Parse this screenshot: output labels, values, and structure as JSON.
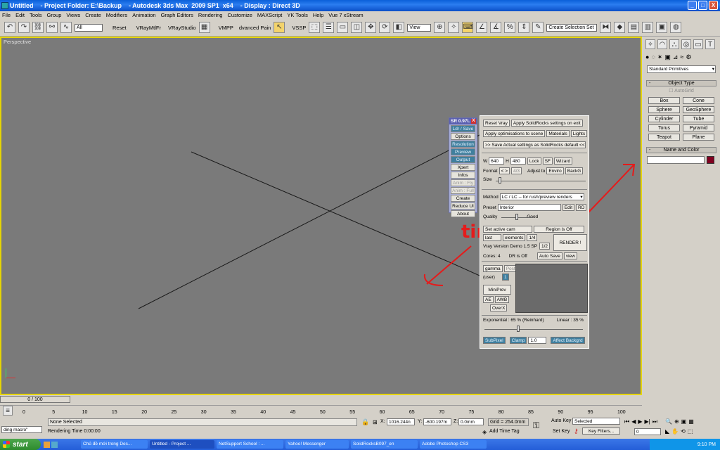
{
  "window": {
    "title": "Untitled    - Project Folder: E:\\Backup    - Autodesk 3ds Max  2009 SP1  x64    - Display : Direct 3D",
    "btn_min": "_",
    "btn_max": "□",
    "btn_close": "X"
  },
  "menu": [
    "File",
    "Edit",
    "Tools",
    "Group",
    "Views",
    "Create",
    "Modifiers",
    "Animation",
    "Graph Editors",
    "Rendering",
    "Customize",
    "MAXScript",
    "YK Tools",
    "Help",
    "Vue 7 xStream"
  ],
  "toolbar": {
    "filter": "All",
    "reset": "Reset",
    "vray_mtl": "VRayMtlFr",
    "vray_studio": "VRayStudio",
    "vmpp": "VMPP",
    "advanced_paint": "dvanced Pain",
    "vssp": "VSSP",
    "view": "View",
    "selection_set": "Create Selection Set"
  },
  "viewport": {
    "label": "Perspective"
  },
  "command_panel": {
    "dropdown": "Standard Primitives",
    "object_type": "Object Type",
    "autogrid": "AutoGrid",
    "primitives": [
      "Box",
      "Cone",
      "Sphere",
      "GeoSphere",
      "Cylinder",
      "Tube",
      "Torus",
      "Pyramid",
      "Teapot",
      "Plane"
    ],
    "name_color": "Name and Color",
    "color": "#800020"
  },
  "sr_panel": {
    "title": "SR 0.97L",
    "close": "X",
    "items": [
      {
        "label": "Ldr / Save",
        "state": "on"
      },
      {
        "label": "Options",
        "state": "normal"
      },
      {
        "label": "Resolution",
        "state": "on"
      },
      {
        "label": "Preview",
        "state": "on"
      },
      {
        "label": "Output",
        "state": "on"
      },
      {
        "label": "Xpert",
        "state": "normal"
      },
      {
        "label": "Infos",
        "state": "normal"
      },
      {
        "label": "Anim : Fly",
        "state": "dis"
      },
      {
        "label": "Anim : Full",
        "state": "dis"
      },
      {
        "label": "Create",
        "state": "normal"
      },
      {
        "label": "Reduce UI",
        "state": "normal"
      },
      {
        "label": "About",
        "state": "normal"
      }
    ]
  },
  "main_panel": {
    "reset_vray": "Reset Vray",
    "apply_exit": "Apply SolidRocks settings on exit",
    "apply_opt": "Apply optimisations to scene",
    "materials": "Materials",
    "lights": "Lights",
    "save_default": ">> Save Actual settings as SolidRocks default <<",
    "w_label": "W",
    "w_value": "640",
    "h_label": "H",
    "h_value": "480",
    "lock": "Lock",
    "sf": "SF",
    "wizard": "Wizard",
    "format": "Format",
    "format_arrows": "< >",
    "aspect": "4/3",
    "adjust_to": "Adjust to",
    "enviro": "Enviro",
    "backg": "BackG",
    "size": "Size",
    "method_label": "Method",
    "method_value": "LC / LC -- for rush/preview renders",
    "preset_label": "Preset",
    "preset_value": "Interior",
    "edit": "Edit",
    "rd": "RD",
    "quality": "Quality",
    "good": "Good",
    "set_active": "Set active cam",
    "region": "Region is Off",
    "last": "last",
    "elements": "elements",
    "half": "1/4",
    "quarter": "1/2",
    "render": "RENDER !",
    "vray_version": "Vray Version   Demo 1.5 SP",
    "cores": "Cores: 4",
    "dr": "DR is Off",
    "autosave": "Auto Save",
    "view": "view",
    "gamma": "gamma",
    "post": "Post",
    "user": "(user)",
    "checkbox": "1",
    "miniprev": "MiniPrev",
    "ae": "AE",
    "awb": "AWB",
    "overx": "OverX",
    "exposure": "Exponential : 65 %   (Reinhard)",
    "linear": "Linear : 35 %",
    "subpixel": "SubPixel",
    "clamp": "Clamp",
    "clamp_value": "1.0",
    "affect_bg": "Affect Backgrd"
  },
  "annotations": [
    "time",
    "time"
  ],
  "timebar": {
    "slider": "0 / 100",
    "ticks": [
      "0",
      "5",
      "10",
      "15",
      "20",
      "25",
      "30",
      "35",
      "40",
      "45",
      "50",
      "55",
      "60",
      "65",
      "70",
      "75",
      "80",
      "85",
      "90",
      "95",
      "100"
    ]
  },
  "status": {
    "macro": "ding macro\"",
    "none_selected": "None Selected",
    "render_time": "Rendering Time  0:00:00",
    "x_label": "X:",
    "x_value": "1016.244n",
    "y_label": "Y:",
    "y_value": "-600.197m",
    "z_label": "Z:",
    "z_value": "0.0mm",
    "grid": "Grid = 254.0mm",
    "add_time_tag": "Add Time Tag",
    "auto_key": "Auto Key",
    "selected": "Selected",
    "set_key": "Set Key",
    "key_filters": "Key Filters...",
    "frame": "0"
  },
  "taskbar": {
    "start": "start",
    "tasks": [
      "Chủ đề mới trong Des...",
      "Untitled    - Project ...",
      "NetSupport School : ...",
      "Yahoo! Messenger",
      "SolidRocksB097_en",
      "Adobe Photoshop CS3"
    ],
    "clock": "9:10 PM"
  }
}
